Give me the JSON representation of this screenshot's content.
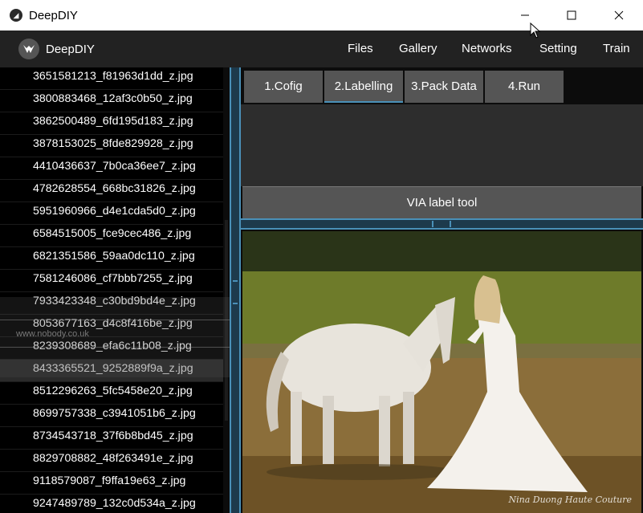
{
  "window": {
    "title": "DeepDIY"
  },
  "menubar": {
    "brand": "DeepDIY",
    "items": [
      "Files",
      "Gallery",
      "Networks",
      "Setting",
      "Train"
    ]
  },
  "files": [
    "3651581213_f81963d1dd_z.jpg",
    "3800883468_12af3c0b50_z.jpg",
    "3862500489_6fd195d183_z.jpg",
    "3878153025_8fde829928_z.jpg",
    "4410436637_7b0ca36ee7_z.jpg",
    "4782628554_668bc31826_z.jpg",
    "5951960966_d4e1cda5d0_z.jpg",
    "6584515005_fce9cec486_z.jpg",
    "6821351586_59aa0dc110_z.jpg",
    "7581246086_cf7bbb7255_z.jpg",
    "7933423348_c30bd9bd4e_z.jpg",
    "8053677163_d4c8f416be_z.jpg",
    "8239308689_efa6c11b08_z.jpg",
    "8433365521_9252889f9a_z.jpg",
    "8512296263_5fc5458e20_z.jpg",
    "8699757338_c3941051b6_z.jpg",
    "8734543718_37f6b8bd45_z.jpg",
    "8829708882_48f263491e_z.jpg",
    "9118579087_f9ffa19e63_z.jpg",
    "9247489789_132c0d534a_z.jpg"
  ],
  "selected_file_index": 13,
  "tabs": [
    "1.Cofig",
    "2.Labelling",
    "3.Pack Data",
    "4.Run"
  ],
  "active_tab_index": 1,
  "via_button_label": "VIA label tool",
  "ghost_url": "www.nobody.co.uk",
  "image": {
    "watermark": "Nina Duong Haute Couture"
  },
  "colors": {
    "accent": "#4a90b8",
    "menubar": "#222222",
    "button": "#555555"
  }
}
